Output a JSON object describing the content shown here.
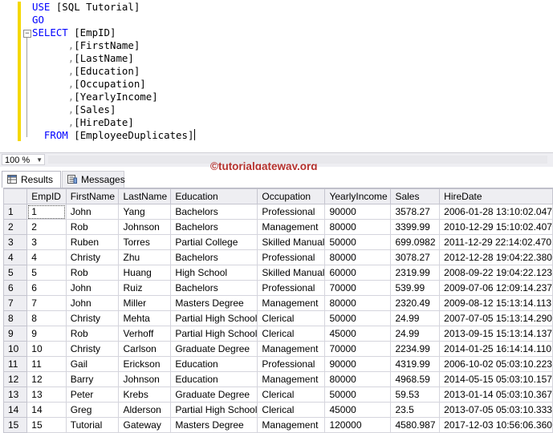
{
  "editor": {
    "lines": [
      {
        "tokens": [
          {
            "t": "USE ",
            "c": "kw"
          },
          {
            "t": "[SQL Tutorial]",
            "c": "tx"
          }
        ]
      },
      {
        "tokens": [
          {
            "t": "GO",
            "c": "kw"
          }
        ]
      },
      {
        "tokens": [
          {
            "t": "SELECT ",
            "c": "kw"
          },
          {
            "t": "[EmpID]",
            "c": "tx"
          }
        ]
      },
      {
        "indent": "      ",
        "tokens": [
          {
            "t": ",",
            "c": "cm"
          },
          {
            "t": "[FirstName]",
            "c": "tx"
          }
        ]
      },
      {
        "indent": "      ",
        "tokens": [
          {
            "t": ",",
            "c": "cm"
          },
          {
            "t": "[LastName]",
            "c": "tx"
          }
        ]
      },
      {
        "indent": "      ",
        "tokens": [
          {
            "t": ",",
            "c": "cm"
          },
          {
            "t": "[Education]",
            "c": "tx"
          }
        ]
      },
      {
        "indent": "      ",
        "tokens": [
          {
            "t": ",",
            "c": "cm"
          },
          {
            "t": "[Occupation]",
            "c": "tx"
          }
        ]
      },
      {
        "indent": "      ",
        "tokens": [
          {
            "t": ",",
            "c": "cm"
          },
          {
            "t": "[YearlyIncome]",
            "c": "tx"
          }
        ]
      },
      {
        "indent": "      ",
        "tokens": [
          {
            "t": ",",
            "c": "cm"
          },
          {
            "t": "[Sales]",
            "c": "tx"
          }
        ]
      },
      {
        "indent": "      ",
        "tokens": [
          {
            "t": ",",
            "c": "cm"
          },
          {
            "t": "[HireDate]",
            "c": "tx"
          }
        ]
      },
      {
        "indent": "  ",
        "tokens": [
          {
            "t": "FROM ",
            "c": "kw"
          },
          {
            "t": "[EmployeeDuplicates]",
            "c": "tx"
          }
        ],
        "caret": true
      }
    ]
  },
  "zoom": {
    "value": "100 %"
  },
  "watermark": "©tutorialgateway.org",
  "tabs": {
    "results": "Results",
    "messages": "Messages"
  },
  "grid": {
    "columns": [
      "EmpID",
      "FirstName",
      "LastName",
      "Education",
      "Occupation",
      "YearlyIncome",
      "Sales",
      "HireDate"
    ],
    "rows": [
      [
        "1",
        "1",
        "John",
        "Yang",
        "Bachelors",
        "Professional",
        "90000",
        "3578.27",
        "2006-01-28 13:10:02.047"
      ],
      [
        "2",
        "2",
        "Rob",
        "Johnson",
        "Bachelors",
        "Management",
        "80000",
        "3399.99",
        "2010-12-29 15:10:02.407"
      ],
      [
        "3",
        "3",
        "Ruben",
        "Torres",
        "Partial College",
        "Skilled Manual",
        "50000",
        "699.0982",
        "2011-12-29 22:14:02.470"
      ],
      [
        "4",
        "4",
        "Christy",
        "Zhu",
        "Bachelors",
        "Professional",
        "80000",
        "3078.27",
        "2012-12-28 19:04:22.380"
      ],
      [
        "5",
        "5",
        "Rob",
        "Huang",
        "High School",
        "Skilled Manual",
        "60000",
        "2319.99",
        "2008-09-22 19:04:22.123"
      ],
      [
        "6",
        "6",
        "John",
        "Ruiz",
        "Bachelors",
        "Professional",
        "70000",
        "539.99",
        "2009-07-06 12:09:14.237"
      ],
      [
        "7",
        "7",
        "John",
        "Miller",
        "Masters Degree",
        "Management",
        "80000",
        "2320.49",
        "2009-08-12 15:13:14.113"
      ],
      [
        "8",
        "8",
        "Christy",
        "Mehta",
        "Partial High School",
        "Clerical",
        "50000",
        "24.99",
        "2007-07-05 15:13:14.290"
      ],
      [
        "9",
        "9",
        "Rob",
        "Verhoff",
        "Partial High School",
        "Clerical",
        "45000",
        "24.99",
        "2013-09-15 15:13:14.137"
      ],
      [
        "10",
        "10",
        "Christy",
        "Carlson",
        "Graduate Degree",
        "Management",
        "70000",
        "2234.99",
        "2014-01-25 16:14:14.110"
      ],
      [
        "11",
        "11",
        "Gail",
        "Erickson",
        "Education",
        "Professional",
        "90000",
        "4319.99",
        "2006-10-02 05:03:10.223"
      ],
      [
        "12",
        "12",
        "Barry",
        "Johnson",
        "Education",
        "Management",
        "80000",
        "4968.59",
        "2014-05-15 05:03:10.157"
      ],
      [
        "13",
        "13",
        "Peter",
        "Krebs",
        "Graduate Degree",
        "Clerical",
        "50000",
        "59.53",
        "2013-01-14 05:03:10.367"
      ],
      [
        "14",
        "14",
        "Greg",
        "Alderson",
        "Partial High School",
        "Clerical",
        "45000",
        "23.5",
        "2013-07-05 05:03:10.333"
      ],
      [
        "15",
        "15",
        "Tutorial",
        "Gateway",
        "Masters Degree",
        "Management",
        "120000",
        "4580.987",
        "2017-12-03 10:56:06.360"
      ]
    ]
  }
}
